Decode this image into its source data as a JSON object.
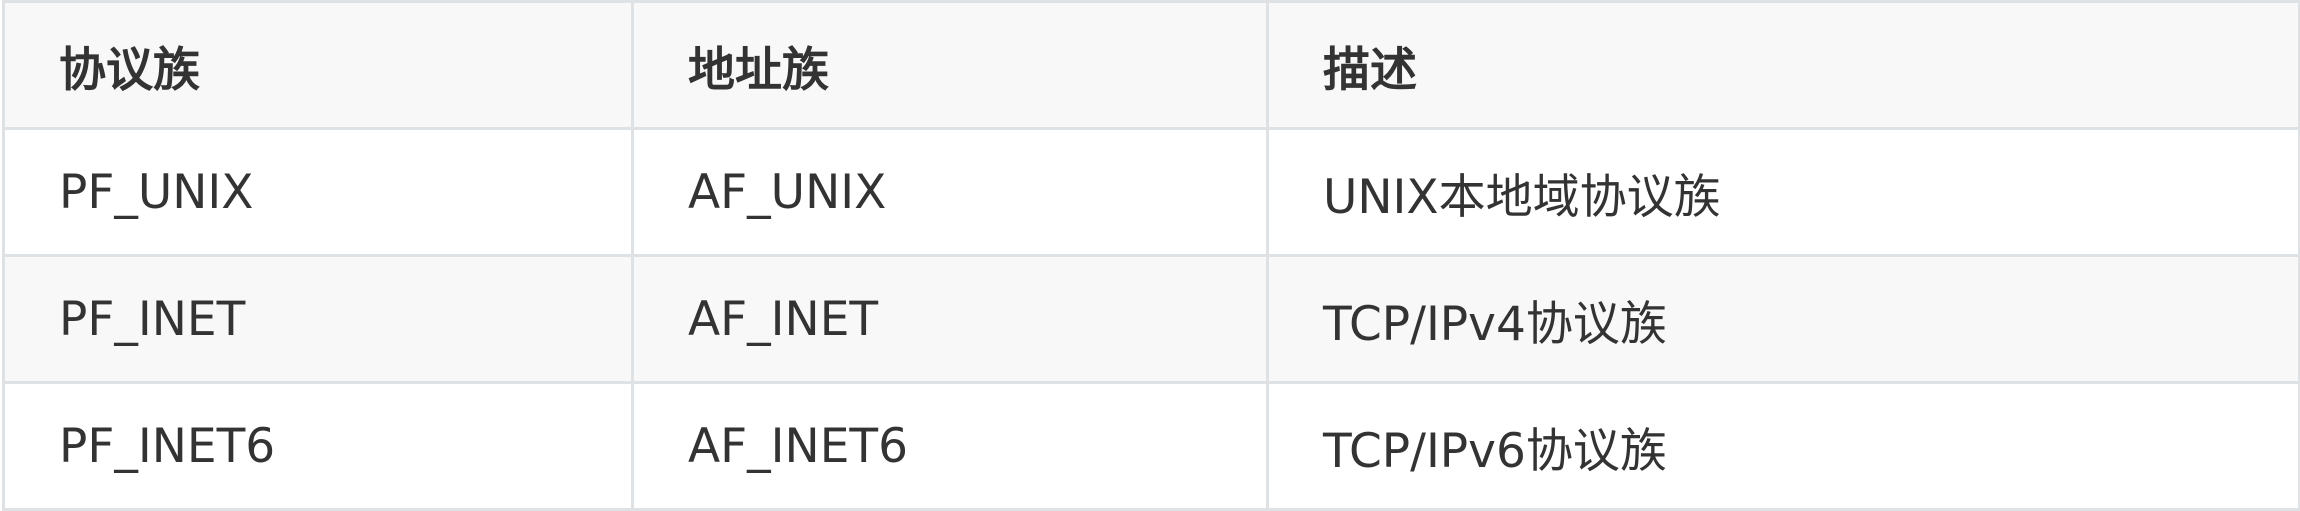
{
  "table": {
    "headers": [
      "协议族",
      "地址族",
      "描述"
    ],
    "rows": [
      [
        "PF_UNIX",
        "AF_UNIX",
        "UNIX本地域协议族"
      ],
      [
        "PF_INET",
        "AF_INET",
        "TCP/IPv4协议族"
      ],
      [
        "PF_INET6",
        "AF_INET6",
        "TCP/IPv6协议族"
      ]
    ]
  }
}
